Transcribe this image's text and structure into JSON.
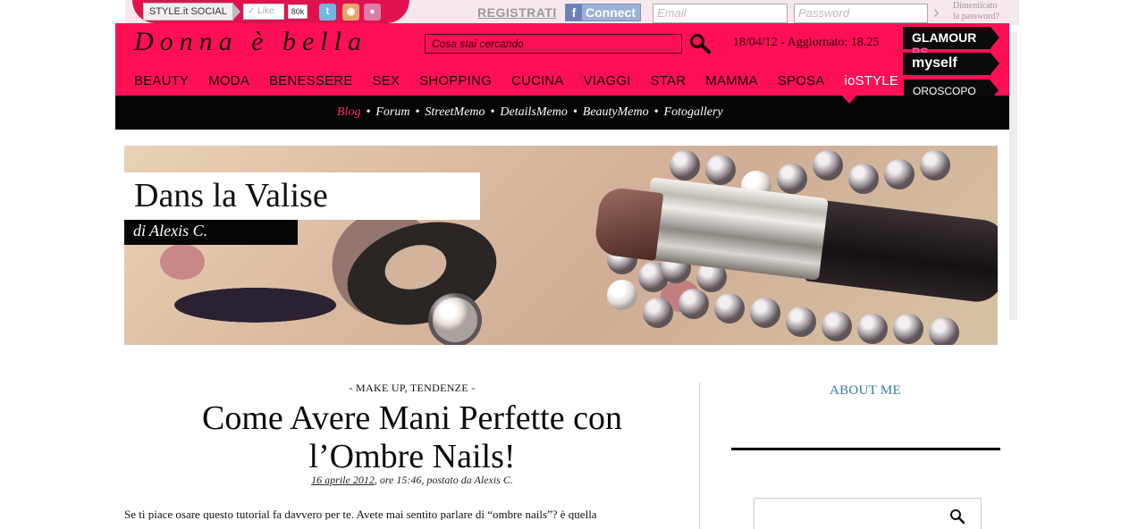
{
  "topbar": {
    "style_social": "STYLE.it  SOCIAL",
    "like_label": "Like",
    "like_count": "80k",
    "register_link": "REGISTRATI",
    "separator": "·",
    "fb_connect_label": "Connect",
    "email_placeholder": "Email",
    "password_placeholder": "Password",
    "go_arrow": "›",
    "forgot_password_line1": "Dimenticato",
    "forgot_password_line2": "la password?",
    "icons": [
      "twitter-icon",
      "rss-icon",
      "flickr-icon"
    ]
  },
  "header": {
    "brand": "Donna è bella",
    "search_placeholder": "Cosa stai cercando",
    "datetime": "18/04/12 - Aggiornato: 18.25",
    "right_logos": {
      "glamour": "GLAMOUR",
      "glamour_ps": "PS",
      "myself": "myself",
      "oroscopo": "OROSCOPO"
    },
    "nav": [
      "BEAUTY",
      "MODA",
      "BENESSERE",
      "SEX",
      "SHOPPING",
      "CUCINA",
      "VIAGGI",
      "STAR",
      "MAMMA",
      "SPOSA",
      "ioSTYLE"
    ],
    "active_nav": "ioSTYLE"
  },
  "subnav": {
    "items": [
      "Blog",
      "Forum",
      "StreetMemo",
      "DetailsMemo",
      "BeautyMemo",
      "Fotogallery"
    ],
    "bullet": "•",
    "active": "Blog"
  },
  "banner": {
    "title": "Dans la Valise",
    "author": "di Alexis C."
  },
  "post": {
    "categories": "-  MAKE UP, TENDENZE  -",
    "title_line1": "Come Avere Mani Perfette con",
    "title_line2": "l’Ombre Nails!",
    "date": "16 aprile 2012",
    "meta_rest": ", ore 15:46, postato da Alexis C.",
    "excerpt": "Se ti piace osare questo tutorial fa davvero per te. Avete mai sentito parlare di “ombre nails”? è quella"
  },
  "sidebar": {
    "about_heading": "ABOUT ME"
  },
  "colors": {
    "pink": "#ff0f55",
    "black": "#050505",
    "link_blue": "#2f7ea3"
  }
}
